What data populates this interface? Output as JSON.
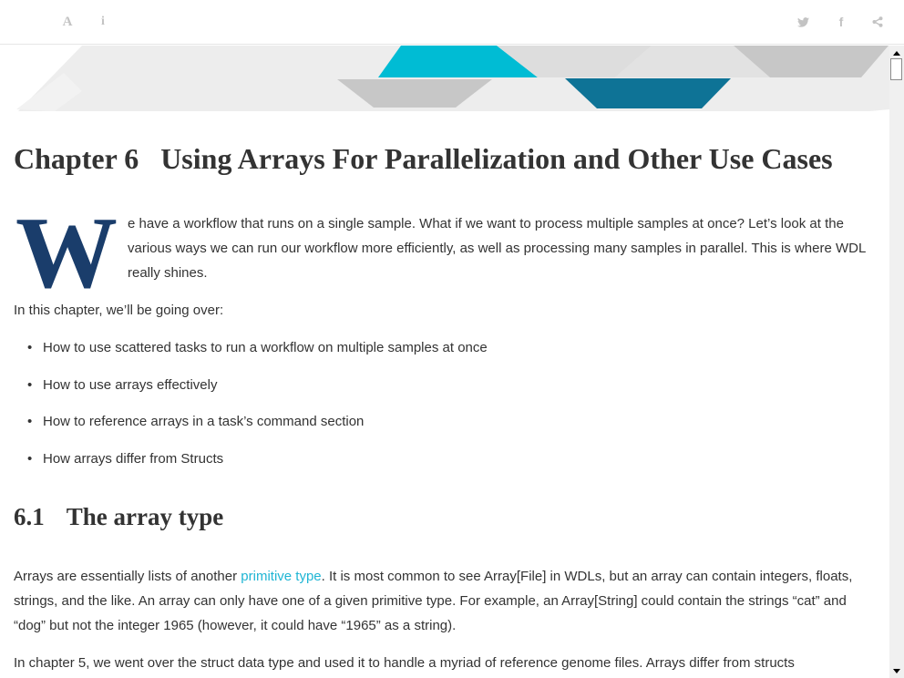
{
  "toolbar": {
    "icons": [
      "font-icon",
      "info-icon",
      "twitter-icon",
      "facebook-icon",
      "share-icon"
    ],
    "font_glyph": "A",
    "info_glyph": "i",
    "facebook_glyph": "f",
    "icon_color": "#c3c3c3"
  },
  "chapter": {
    "number": "Chapter 6",
    "title": "Using Arrays For Parallelization and Other Use Cases"
  },
  "intro": {
    "dropcap": "W",
    "text": "e have a workflow that runs on a single sample. What if we want to process multiple samples at once? Let’s look at the various ways we can run our workflow more efficiently, as well as processing many samples in parallel. This is where WDL really shines."
  },
  "overview_lead": "In this chapter, we’ll be going over:",
  "bullet_glyph": "•",
  "overview_items": [
    "How to use scattered tasks to run a workflow on multiple samples at once",
    "How to use arrays effectively",
    "How to reference arrays in a task’s command section",
    "How arrays differ from Structs"
  ],
  "section": {
    "number": "6.1",
    "title": "The array type"
  },
  "para1": {
    "before": "Arrays are essentially lists of another ",
    "link": "primitive type",
    "after": ". It is most common to see Array[File] in WDLs, but an array can contain integers, floats, strings, and the like. An array can only have one of a given primitive type. For example, an Array[String] could contain the strings “cat” and “dog” but not the integer 1965 (however, it could have “1965” as a string)."
  },
  "para2": "In chapter 5, we went over the struct data type and used it to handle a myriad of reference genome files. Arrays differ from structs",
  "colors": {
    "accent_cyan": "#00bcd4",
    "accent_teal": "#0e7396",
    "dropcap_navy": "#1a3d6b",
    "link": "#1fb5d4",
    "banner_gray": "#c7c7c7",
    "banner_light": "#e6e6e6"
  }
}
